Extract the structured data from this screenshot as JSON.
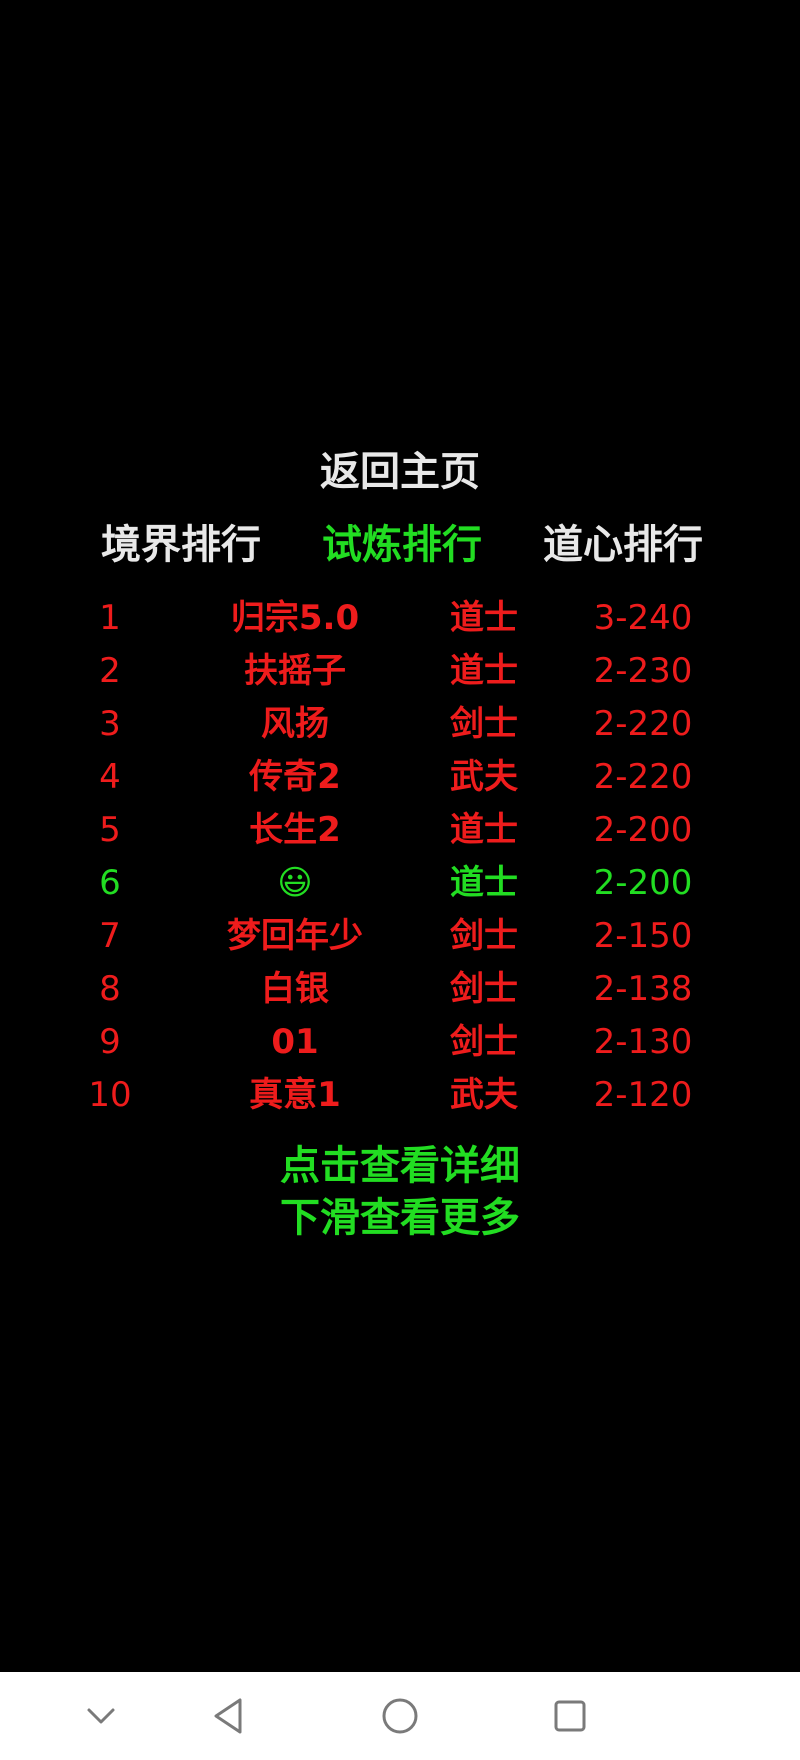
{
  "colors": {
    "background": "#000000",
    "default_text": "#e8e8e8",
    "active_tab": "#22dd22",
    "rank_red": "#ee1c1c",
    "highlight_green": "#22dd22",
    "action_green": "#22dd22",
    "nav_bar": "#ffffff",
    "nav_icon": "#7a7a7a"
  },
  "header": {
    "home_label": "返回主页"
  },
  "tabs": [
    {
      "label": "境界排行",
      "active": false
    },
    {
      "label": "试炼排行",
      "active": true
    },
    {
      "label": "道心排行",
      "active": false
    }
  ],
  "rankings": [
    {
      "rank": "1",
      "name": "归宗5.0",
      "class": "道士",
      "level": "3-240",
      "highlight": false
    },
    {
      "rank": "2",
      "name": "扶摇子",
      "class": "道士",
      "level": "2-230",
      "highlight": false
    },
    {
      "rank": "3",
      "name": "风扬",
      "class": "剑士",
      "level": "2-220",
      "highlight": false
    },
    {
      "rank": "4",
      "name": "传奇2",
      "class": "武夫",
      "level": "2-220",
      "highlight": false
    },
    {
      "rank": "5",
      "name": "长生2",
      "class": "道士",
      "level": "2-200",
      "highlight": false
    },
    {
      "rank": "6",
      "name": "😃",
      "class": "道士",
      "level": "2-200",
      "highlight": true
    },
    {
      "rank": "7",
      "name": "梦回年少",
      "class": "剑士",
      "level": "2-150",
      "highlight": false
    },
    {
      "rank": "8",
      "name": "白银",
      "class": "剑士",
      "level": "2-138",
      "highlight": false
    },
    {
      "rank": "9",
      "name": "01",
      "class": "剑士",
      "level": "2-130",
      "highlight": false
    },
    {
      "rank": "10",
      "name": "真意1",
      "class": "武夫",
      "level": "2-120",
      "highlight": false
    }
  ],
  "actions": {
    "view_details": "点击查看详细",
    "scroll_more": "下滑查看更多"
  },
  "nav_bar": {
    "icons": [
      "chevron-down-icon",
      "back-triangle-icon",
      "home-circle-icon",
      "recents-square-icon"
    ]
  }
}
